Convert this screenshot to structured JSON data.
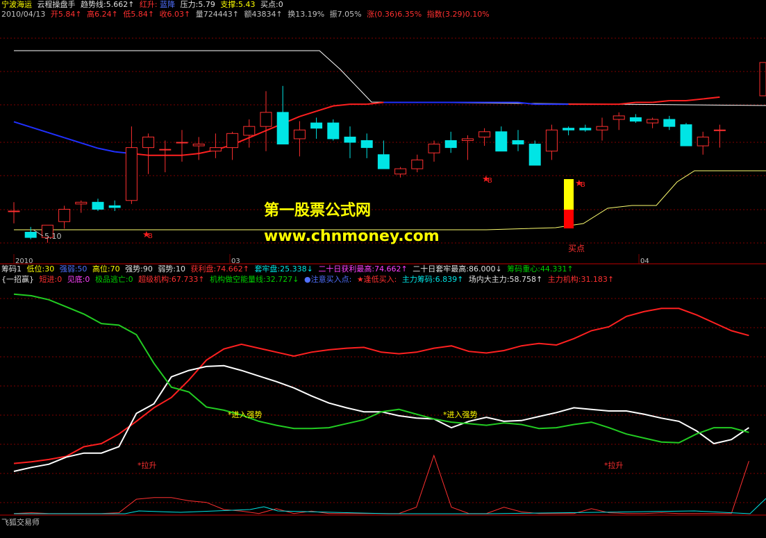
{
  "header": {
    "stock_name": "宁波海运",
    "panel_name": "云程操盘手",
    "trend_label": "趋势线:5.662↑",
    "red_rise": "红升:",
    "blue_fall": "蓝降",
    "pressure": "压力:5.79",
    "support": "支撑:5.43",
    "buy_point": "买点:0"
  },
  "quote": {
    "date": "2010/04/13",
    "open": "开5.84↑",
    "high": "高6.24↑",
    "low": "低5.84↑",
    "close": "收6.03↑",
    "volume": "量724443↑",
    "amount": "额43834↑",
    "turnover": "换13.19%",
    "amplitude": "振7.05%",
    "change": "涨(0.36)6.35%",
    "index": "指数(3.29)0.10%"
  },
  "chips": {
    "label": "筹码1",
    "low": "低位:30",
    "strong_weak": "强弱:50",
    "high": "高位:70",
    "strong": "强势:90",
    "weak": "弱势:10",
    "profit": "获利盘:74.662↑",
    "trapped": "套牢盘:25.338↓",
    "max_profit_20": "二十日获利最高:74.662↑",
    "max_trapped_20": "二十日套牢最高:86.000↓",
    "center": "筹码重心:44.331↑"
  },
  "indicator": {
    "label": "{一招赢}",
    "short_in": "短进:0",
    "see_bottom": "见底:0",
    "top_escape": "极品逃亡:0",
    "super_inst": "超级机构:67.733↑",
    "inst_short": "机构做空能量线:32.727↓",
    "notice_buy": "●注意买入点:",
    "low_buy": "★逢低买入:",
    "main_chips": "主力筹码:6.839↑",
    "field_main": "场内大主力:58.758↑",
    "main_inst": "主力机构:31.183↑"
  },
  "annotations": {
    "price_min": "5.10",
    "buy_text": "买点",
    "star_b": "B",
    "enter_strong": "*进入强势",
    "pull_up": "*拉升"
  },
  "x_axis_labels": [
    "2010",
    "03",
    "04"
  ],
  "footer": "飞狐交易师",
  "watermark": {
    "title": "第一股票公式网",
    "url": "www.chnmoney.com"
  },
  "colors": {
    "up": "#ff3030",
    "down": "#00e5e5",
    "trend_up": "#ff2020",
    "trend_down": "#2030ff",
    "pressure_line": "#ffffff",
    "support_line": "#ffff70",
    "profit_line": "#ff2020",
    "strong_line": "#ffffff",
    "green_line": "#22cc22",
    "cyan_line": "#00e5e5"
  },
  "chart_data": [
    {
      "type": "candlestick",
      "title": "宁波海运",
      "x_labels": [
        "2010",
        "03",
        "04"
      ],
      "candles": [
        {
          "o": 5.26,
          "h": 5.31,
          "l": 5.19,
          "c": 5.26
        },
        {
          "o": 5.14,
          "h": 5.17,
          "l": 5.1,
          "c": 5.11
        },
        {
          "o": 5.11,
          "h": 5.18,
          "l": 5.08,
          "c": 5.18
        },
        {
          "o": 5.2,
          "h": 5.29,
          "l": 5.16,
          "c": 5.27
        },
        {
          "o": 5.3,
          "h": 5.32,
          "l": 5.25,
          "c": 5.31
        },
        {
          "o": 5.31,
          "h": 5.33,
          "l": 5.26,
          "c": 5.27
        },
        {
          "o": 5.29,
          "h": 5.32,
          "l": 5.26,
          "c": 5.28
        },
        {
          "o": 5.32,
          "h": 5.74,
          "l": 5.3,
          "c": 5.62
        },
        {
          "o": 5.62,
          "h": 5.7,
          "l": 5.47,
          "c": 5.68
        },
        {
          "o": 5.61,
          "h": 5.66,
          "l": 5.48,
          "c": 5.61
        },
        {
          "o": 5.65,
          "h": 5.72,
          "l": 5.54,
          "c": 5.65
        },
        {
          "o": 5.63,
          "h": 5.68,
          "l": 5.55,
          "c": 5.64
        },
        {
          "o": 5.6,
          "h": 5.7,
          "l": 5.56,
          "c": 5.62
        },
        {
          "o": 5.62,
          "h": 5.71,
          "l": 5.55,
          "c": 5.7
        },
        {
          "o": 5.69,
          "h": 5.78,
          "l": 5.62,
          "c": 5.74
        },
        {
          "o": 5.74,
          "h": 5.94,
          "l": 5.6,
          "c": 5.82
        },
        {
          "o": 5.82,
          "h": 5.97,
          "l": 5.78,
          "c": 5.64
        },
        {
          "o": 5.67,
          "h": 5.77,
          "l": 5.57,
          "c": 5.72
        },
        {
          "o": 5.76,
          "h": 5.79,
          "l": 5.67,
          "c": 5.73
        },
        {
          "o": 5.76,
          "h": 5.78,
          "l": 5.66,
          "c": 5.67
        },
        {
          "o": 5.68,
          "h": 5.74,
          "l": 5.56,
          "c": 5.65
        },
        {
          "o": 5.66,
          "h": 5.7,
          "l": 5.56,
          "c": 5.62
        },
        {
          "o": 5.58,
          "h": 5.66,
          "l": 5.5,
          "c": 5.5
        },
        {
          "o": 5.47,
          "h": 5.51,
          "l": 5.45,
          "c": 5.5
        },
        {
          "o": 5.5,
          "h": 5.58,
          "l": 5.48,
          "c": 5.55
        },
        {
          "o": 5.59,
          "h": 5.66,
          "l": 5.54,
          "c": 5.64
        },
        {
          "o": 5.66,
          "h": 5.71,
          "l": 5.59,
          "c": 5.62
        },
        {
          "o": 5.66,
          "h": 5.69,
          "l": 5.55,
          "c": 5.67
        },
        {
          "o": 5.68,
          "h": 5.73,
          "l": 5.63,
          "c": 5.71
        },
        {
          "o": 5.71,
          "h": 5.74,
          "l": 5.6,
          "c": 5.6
        },
        {
          "o": 5.66,
          "h": 5.72,
          "l": 5.6,
          "c": 5.64
        },
        {
          "o": 5.64,
          "h": 5.66,
          "l": 5.52,
          "c": 5.52
        },
        {
          "o": 5.6,
          "h": 5.75,
          "l": 5.55,
          "c": 5.72
        },
        {
          "o": 5.73,
          "h": 5.74,
          "l": 5.69,
          "c": 5.72
        },
        {
          "o": 5.73,
          "h": 5.75,
          "l": 5.71,
          "c": 5.72
        },
        {
          "o": 5.72,
          "h": 5.79,
          "l": 5.66,
          "c": 5.74
        },
        {
          "o": 5.78,
          "h": 5.82,
          "l": 5.72,
          "c": 5.8
        },
        {
          "o": 5.79,
          "h": 5.81,
          "l": 5.76,
          "c": 5.77
        },
        {
          "o": 5.76,
          "h": 5.79,
          "l": 5.73,
          "c": 5.78
        },
        {
          "o": 5.78,
          "h": 5.8,
          "l": 5.72,
          "c": 5.74
        },
        {
          "o": 5.75,
          "h": 5.76,
          "l": 5.63,
          "c": 5.63
        },
        {
          "o": 5.63,
          "h": 5.71,
          "l": 5.58,
          "c": 5.68
        },
        {
          "o": 5.72,
          "h": 5.75,
          "l": 5.62,
          "c": 5.72
        }
      ],
      "trend_line": [
        5.53,
        5.5,
        5.47,
        5.44,
        5.41,
        5.38,
        5.36,
        5.35,
        5.34,
        5.34,
        5.34,
        5.35,
        5.37,
        5.4,
        5.44,
        5.48,
        5.52,
        5.56,
        5.59,
        5.62,
        5.63,
        5.63,
        5.64,
        5.64,
        5.64,
        5.64,
        5.64,
        5.64,
        5.64,
        5.64,
        5.64,
        5.63,
        5.63,
        5.63,
        5.63,
        5.63,
        5.63,
        5.64,
        5.64,
        5.65,
        5.65,
        5.66,
        5.67
      ],
      "pressure_line": [
        5.79
      ],
      "support_line": [
        5.43
      ],
      "min_marker": 5.1,
      "buy_markers": [
        "B",
        "B",
        "B"
      ],
      "ylim": [
        5.0,
        6.3
      ]
    },
    {
      "type": "line",
      "title": "{一招赢}",
      "x_labels": [],
      "series": [
        {
          "name": "超级机构",
          "color": "#ff2020",
          "values": [
            65,
            67,
            70,
            74,
            86,
            90,
            102,
            118,
            135,
            148,
            170,
            195,
            209,
            215,
            210,
            205,
            200,
            205,
            208,
            210,
            211,
            205,
            203,
            205,
            210,
            213,
            206,
            204,
            207,
            213,
            216,
            214,
            222,
            232,
            237,
            250,
            256,
            260,
            260,
            252,
            242,
            232,
            226
          ]
        },
        {
          "name": "机构做空能量线",
          "color": "#ffffff",
          "values": [
            55,
            60,
            64,
            73,
            78,
            78,
            86,
            128,
            140,
            174,
            182,
            187,
            188,
            182,
            175,
            168,
            160,
            150,
            141,
            135,
            130,
            130,
            125,
            122,
            121,
            110,
            118,
            123,
            118,
            119,
            124,
            129,
            135,
            133,
            131,
            131,
            127,
            122,
            118,
            106,
            90,
            95,
            110
          ]
        },
        {
          "name": "主力机构",
          "color": "#22cc22",
          "values": [
            278,
            276,
            271,
            262,
            253,
            241,
            239,
            227,
            191,
            161,
            155,
            136,
            132,
            126,
            118,
            113,
            109,
            109,
            110,
            115,
            120,
            130,
            133,
            127,
            121,
            117,
            115,
            113,
            116,
            114,
            109,
            110,
            114,
            117,
            110,
            102,
            97,
            92,
            91,
            102,
            110,
            110,
            104
          ]
        },
        {
          "name": "场内大主力",
          "color": "#ff3030",
          "values": [
            2,
            3,
            2,
            2,
            2,
            2,
            3,
            20,
            22,
            22,
            18,
            16,
            7,
            5,
            2,
            8,
            2,
            5,
            2,
            2,
            2,
            2,
            2,
            10,
            75,
            10,
            2,
            2,
            10,
            4,
            2,
            2,
            2,
            8,
            3,
            2,
            2,
            3,
            2,
            2,
            2,
            2,
            68
          ]
        }
      ],
      "annotations": [
        "*进入强势",
        "*进入强势",
        "*拉升",
        "*拉升"
      ],
      "ylim": [
        0,
        290
      ]
    }
  ]
}
